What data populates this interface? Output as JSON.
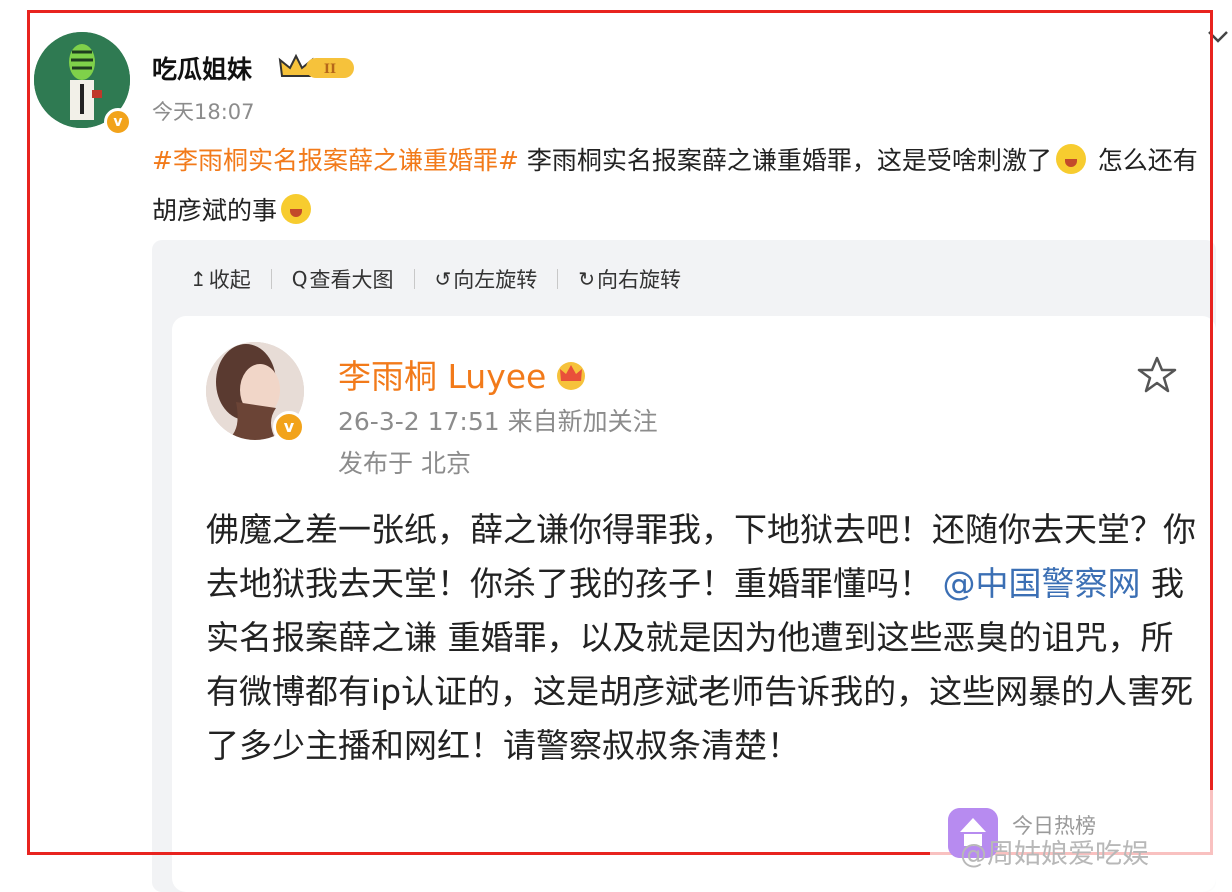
{
  "post": {
    "username": "吃瓜姐妹",
    "verified_mark": "v",
    "timestamp": "今天18:07",
    "hashtag": "#李雨桐实名报案薛之谦重婚罪#",
    "text_before_emoji": " 李雨桐实名报案薛之谦重婚罪，这是受啥刺激了",
    "text_after_emoji": " 怎么还有胡彦斌的事"
  },
  "toolbar": {
    "collapse_icon": "↥",
    "collapse_label": "收起",
    "view_large_icon": "Q",
    "view_large_label": "查看大图",
    "rotate_left_icon": "↺",
    "rotate_left_label": "向左旋转",
    "rotate_right_icon": "↻",
    "rotate_right_label": "向右旋转"
  },
  "embedded_post": {
    "username": "李雨桐 Luyee",
    "verified_mark": "v",
    "meta_time_source": "26-3-2 17:51  来自新加关注",
    "meta_location": "发布于 北京",
    "body_part1": "佛魔之差一张纸，薛之谦你得罪我，下地狱去吧！还随你去天堂？你去地狱我去天堂！你杀了我的孩子！重婚罪懂吗！",
    "mention": "@中国警察网",
    "body_part2": " 我实名报案薛之谦 重婚罪，以及就是因为他遭到这些恶臭的诅咒，所有微博都有ip认证的，这是胡彦斌老师告诉我的，这些网暴的人害死了多少主播和网红！请警察叔叔条清楚！"
  },
  "watermark": {
    "title": "今日热榜",
    "handle": "@周姑娘爱吃娱"
  },
  "icons": {
    "crown_badge": "crown-level-icon",
    "favorite": "star-icon",
    "more": "chevron-down-icon"
  },
  "colors": {
    "frame_border": "#e8231f",
    "hashtag": "#f27a1a",
    "mention": "#3b6fb4",
    "secondary_text": "#8c8c8c",
    "verified_badge": "#f2a31b"
  }
}
